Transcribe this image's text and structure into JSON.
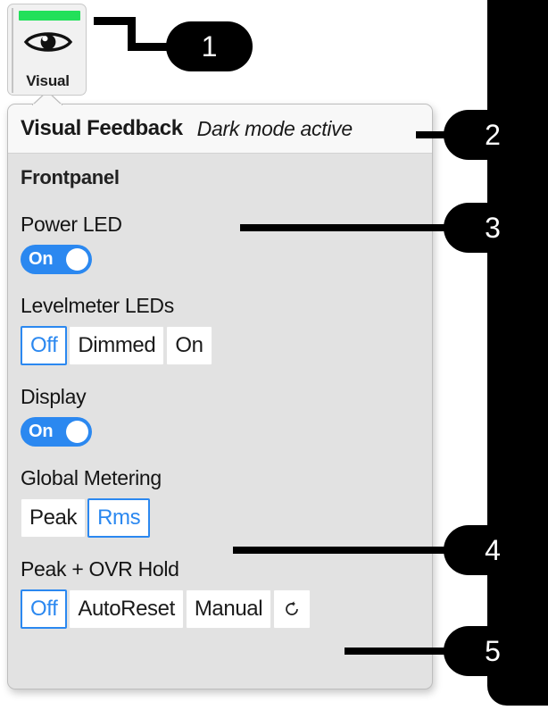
{
  "tab": {
    "label": "Visual",
    "icon": "eye-icon",
    "accent_color": "#22e05a"
  },
  "popover": {
    "title": "Visual Feedback",
    "subtitle": "Dark mode active",
    "section_title": "Frontpanel",
    "fields": [
      {
        "label": "Power LED",
        "control": "toggle",
        "value": "On"
      },
      {
        "label": "Levelmeter LEDs",
        "control": "segmented",
        "options": [
          "Off",
          "Dimmed",
          "On"
        ],
        "selected": "Off"
      },
      {
        "label": "Display",
        "control": "toggle",
        "value": "On"
      },
      {
        "label": "Global Metering",
        "control": "segmented",
        "options": [
          "Peak",
          "Rms"
        ],
        "selected": "Rms"
      },
      {
        "label": "Peak + OVR Hold",
        "control": "segmented",
        "options": [
          "Off",
          "AutoReset",
          "Manual"
        ],
        "selected": "Off",
        "reset_icon": "reset-arrow-icon"
      }
    ]
  },
  "callouts": [
    {
      "number": "1"
    },
    {
      "number": "2"
    },
    {
      "number": "3"
    },
    {
      "number": "4"
    },
    {
      "number": "5"
    }
  ],
  "colors": {
    "accent_blue": "#2b88f0",
    "accent_green": "#22e05a",
    "panel_bg": "#e2e2e2",
    "header_bg": "#f8f8f8",
    "badge_bg": "#000000"
  }
}
